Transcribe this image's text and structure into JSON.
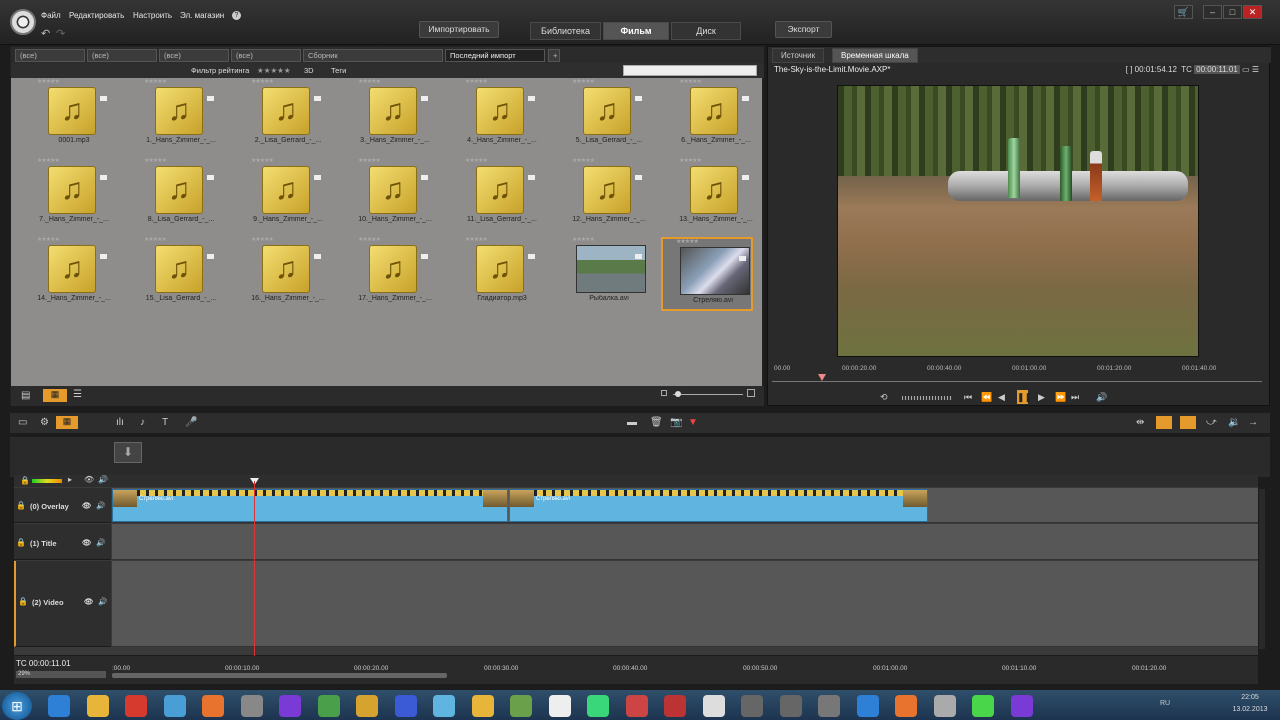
{
  "menu": {
    "items": [
      "Файл",
      "Редактировать",
      "Настроить",
      "Эл. магазин",
      "?"
    ]
  },
  "nav": {
    "import": "Импортировать",
    "tabs": [
      "Библиотека",
      "Фильм",
      "Диск"
    ],
    "active": "Фильм",
    "export": "Экспорт"
  },
  "library": {
    "tabs": [
      "(все)",
      "(все)",
      "(все)",
      "(все)",
      "Сборник",
      "Последний импорт"
    ],
    "filter_label": "Фильтр рейтинга",
    "stars": "★★★★★",
    "btn_3d": "3D",
    "btn_tags": "Теги",
    "items": [
      "0001.mp3",
      "1._Hans_Zimmer_-_...",
      "2._Lisa_Gerrard_-_...",
      "3._Hans_Zimmer_-_...",
      "4._Hans_Zimmer_-_...",
      "5._Lisa_Gerrard_-_...",
      "6._Hans_Zimmer_-_...",
      "7._Hans_Zimmer_-_...",
      "8._Lisa_Gerrard_-_...",
      "9._Hans_Zimmer_-_...",
      "10._Hans_Zimmer_-_...",
      "11._Lisa_Gerrard_-_...",
      "12._Hans_Zimmer_-_...",
      "13._Hans_Zimmer_-_...",
      "14._Hans_Zimmer_-_...",
      "15._Lisa_Gerrard_-_...",
      "16._Hans_Zimmer_-_...",
      "17._Hans_Zimmer_-_...",
      "Гладиатор.mp3",
      "Рыбалка.avi",
      "Стреляю.avi"
    ]
  },
  "preview": {
    "tabs": [
      "Источник",
      "Временная шкала"
    ],
    "active_tab": "Временная шкала",
    "title": "The-Sky-is-the-Limit.Movie.AXP*",
    "duration": "[ ] 00:01:54.12",
    "tc_label": "TC",
    "tc_value": "00:00:11.01",
    "ruler": [
      "00.00",
      "00:00:20.00",
      "00:00:40.00",
      "00:01:00.00",
      "00:01:20.00",
      "00:01:40.00"
    ]
  },
  "timeline": {
    "tracks": [
      "(0) Overlay",
      "(1) Title",
      "(2) Video"
    ],
    "clip_label": "Стреляю.avi",
    "tc": "TC  00:00:11.01",
    "zoom": "29%",
    "ruler": [
      ":00.00",
      "00:00:10.00",
      "00:00:20.00",
      "00:00:30.00",
      "00:00:40.00",
      "00:00:50.00",
      "00:01:00.00",
      "00:01:10.00",
      "00:01:20.00"
    ]
  },
  "taskbar": {
    "lang": "RU",
    "time": "22:05",
    "date": "13.02.2013"
  },
  "colors": {
    "selection": "#e59b2c",
    "clip": "#5fb4e0",
    "playhead": "#d33333"
  }
}
